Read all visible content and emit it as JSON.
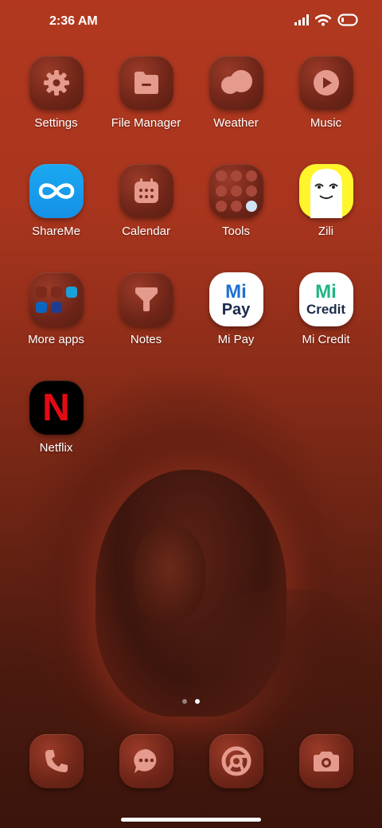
{
  "status_bar": {
    "time": "2:36 AM"
  },
  "home": {
    "apps": [
      {
        "name": "settings",
        "label": "Settings",
        "icon": "gear-icon"
      },
      {
        "name": "file-manager",
        "label": "File Manager",
        "icon": "folder-icon"
      },
      {
        "name": "weather",
        "label": "Weather",
        "icon": "cloud-icon"
      },
      {
        "name": "music",
        "label": "Music",
        "icon": "play-icon"
      },
      {
        "name": "shareme",
        "label": "ShareMe",
        "icon": "infinity-icon"
      },
      {
        "name": "calendar",
        "label": "Calendar",
        "icon": "calendar-icon"
      },
      {
        "name": "tools",
        "label": "Tools",
        "icon": "tools-folder-icon"
      },
      {
        "name": "zili",
        "label": "Zili",
        "icon": "zili-face-icon"
      },
      {
        "name": "more-apps",
        "label": "More apps",
        "icon": "apps-folder-icon"
      },
      {
        "name": "notes",
        "label": "Notes",
        "icon": "notes-icon"
      },
      {
        "name": "mi-pay",
        "label": "Mi Pay",
        "icon": "mi-pay-icon"
      },
      {
        "name": "mi-credit",
        "label": "Mi Credit",
        "icon": "mi-credit-icon"
      },
      {
        "name": "netflix",
        "label": "Netflix",
        "icon": "netflix-icon"
      }
    ],
    "mi_pay": {
      "top": "Mi",
      "bottom": "Pay"
    },
    "mi_credit": {
      "top": "Mi",
      "bottom": "Credit"
    },
    "netflix_letter": "N",
    "page_indicator": {
      "pages": 2,
      "current": 2
    }
  },
  "dock": [
    {
      "name": "phone",
      "icon": "phone-icon"
    },
    {
      "name": "messages",
      "icon": "message-icon"
    },
    {
      "name": "chrome",
      "icon": "chrome-icon"
    },
    {
      "name": "camera",
      "icon": "camera-icon"
    }
  ],
  "colors": {
    "accent_icon": "#e49a8c",
    "icon_bg": "#6e2518",
    "shareme_blue": "#1a9fee",
    "mi_pay_blue": "#1f6fd6",
    "mi_credit_green": "#1fb584",
    "netflix_red": "#e50914"
  }
}
